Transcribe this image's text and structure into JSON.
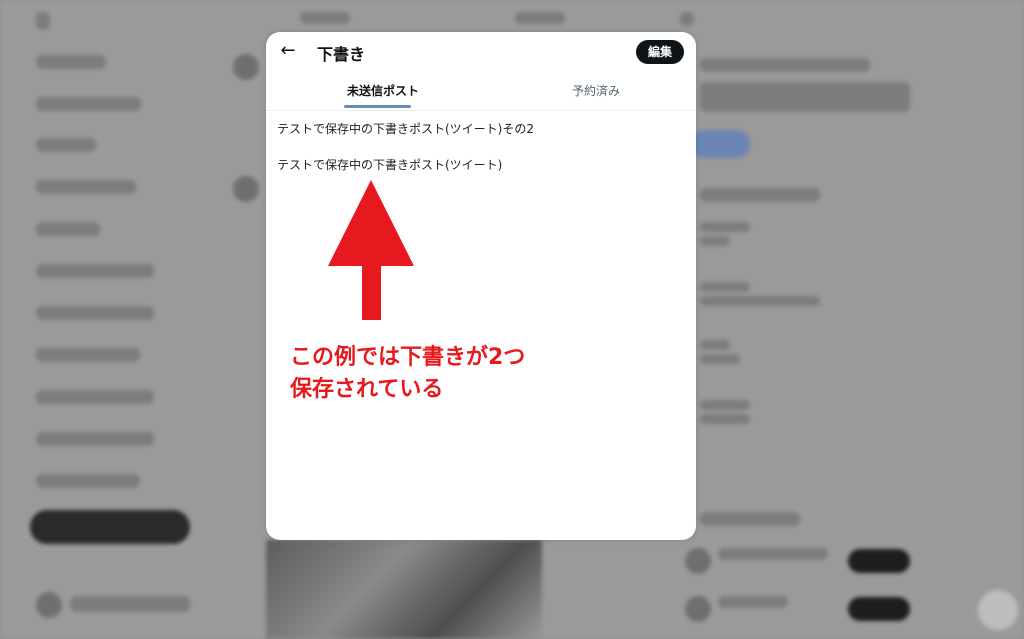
{
  "modal": {
    "back_icon": "←",
    "title": "下書き",
    "edit_label": "編集"
  },
  "tabs": [
    {
      "label": "未送信ポスト",
      "active": true
    },
    {
      "label": "予約済み",
      "active": false
    }
  ],
  "drafts": [
    {
      "text": "テストで保存中の下書きポスト(ツイート)その2"
    },
    {
      "text": "テストで保存中の下書きポスト(ツイート)"
    }
  ],
  "annotation": {
    "line1": "この例では下書きが2つ",
    "line2": "保存されている",
    "color": "#e8191e"
  },
  "colors": {
    "overlay": "#9a9a9a",
    "edit_button_bg": "#0f1419",
    "tab_indicator": "#6b8ab0",
    "arrow": "#e8191e"
  }
}
